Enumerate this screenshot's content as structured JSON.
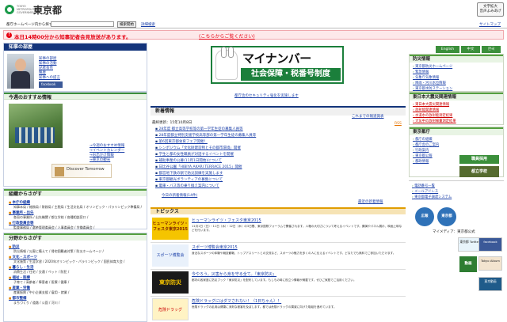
{
  "header": {
    "logo_sub": "TOKYO METROPOLITAN GOVERNMENT",
    "logo_text": "東京都",
    "text_size_button": "文字拡大\n音声よみあげ"
  },
  "search": {
    "label": "都庁ホームページ内から探す",
    "button": "検索開始",
    "detail_link": "詳細検索",
    "sitemap_link": "サイトマップ"
  },
  "alert": {
    "icon": "!",
    "text": "本日14時00分から知事記者会見放送があります。",
    "link": "(こちらからご覧ください)"
  },
  "governor": {
    "title": "知事の部屋",
    "links": [
      "知事の部屋",
      "知事の活動",
      "記者会見",
      "略歴",
      "知事への提言"
    ],
    "facebook": "facebook"
  },
  "recommend": {
    "title": "今週のおすすめ情報",
    "links": [
      "→今週のおすすめ情報",
      "→イベントカレンダー",
      "→お出かけ情報",
      "→東京の観光"
    ],
    "discover_banner": "Discover Tomorrow"
  },
  "org": {
    "title": "組織からさがす",
    "items": [
      {
        "kind": "head",
        "text": "本庁の組織"
      },
      {
        "kind": "sub",
        "text": "知事本局 / 総務局 / 財務局 / 主税局 / 生活文化局 / オリンピック・パラリンピック準備局 /"
      },
      {
        "kind": "head",
        "text": "事業所・出先"
      },
      {
        "kind": "sub",
        "text": "各局の事業所 / 出先機関 / 都立学校 / 各種相談窓口 /"
      },
      {
        "kind": "head",
        "text": "行政委員会等"
      },
      {
        "kind": "sub",
        "text": "監査事務局 / 選挙管理委員会 / 人事委員会 / 労働委員会 /"
      }
    ]
  },
  "field": {
    "title": "分野からさがす",
    "items": [
      {
        "kind": "head",
        "text": "防災"
      },
      {
        "kind": "sub",
        "text": "防災情報 / 災害に備えて / 帰宅困難者対策 / 防災ホームページ /"
      },
      {
        "kind": "head",
        "text": "文化・スポーツ"
      },
      {
        "kind": "sub",
        "text": "文化施策 / 生涯学習 / 2020年オリンピック・パラリンピック / 国民体育大会 /"
      },
      {
        "kind": "head",
        "text": "暮らし・生活"
      },
      {
        "kind": "sub",
        "text": "消費生活 / 住宅 / 交通 / ペット / 防犯 /"
      },
      {
        "kind": "head",
        "text": "福祉・医療"
      },
      {
        "kind": "sub",
        "text": "子育て / 高齢者 / 障害者 / 医療 / 健康 /"
      },
      {
        "kind": "head",
        "text": "産業・労働"
      },
      {
        "kind": "sub",
        "text": "産業振興 / 中小企業支援 / 雇用・就業 /"
      },
      {
        "kind": "head",
        "text": "都市整備"
      },
      {
        "kind": "sub",
        "text": "まちづくり / 道路 / 公園 / 河川 /"
      }
    ]
  },
  "mynumber": {
    "title": "マイナンバー",
    "subtitle": "社会保障・税番号制度",
    "caption": "都庁舎のセキュリティ強化を実施します"
  },
  "news": {
    "title": "新着情報",
    "updated": "最終更新：15年10月8日",
    "more_link": "これまでの報道発表",
    "rss": "RSS",
    "items": [
      "28年度 都立高等学校等の第一学年生徒の募集人員等",
      "28年度都立特別支援学校高等部の第一学年生徒の募集人員等",
      "第6回東京都食育フェア開催！",
      "シンポジウム「文化財建造物とその都市環境」開催",
      "学生と都の女性職員が対話するイベントを開催",
      "補助事業の公募(11月1日開始)について",
      "日比谷公園「HIBIYA AKARI TERRACE 2015」開催",
      "都営地下鉄の駅で防災訓練を実施します",
      "東京都観光ボランティアの募集について",
      "電車・バス等の乗り換え案内について"
    ],
    "list_link": "今日の新着情報(14件)",
    "latest_link": "最近の新着情報"
  },
  "topics": {
    "title": "トピックス",
    "items": [
      {
        "thumb": "ヒューマンライツ・フェスタ東京2015",
        "title": "ヒューマンライツ・フェスタ東京2015",
        "desc": "11月1日（日）・11日（水）・12日（木）の3日間、東京国際フォーラムで開催されます。人権の大切さについて考えるイベントです。講演やパネル展示、映画上映などを行います。"
      },
      {
        "thumb": "スポーツ博覧会",
        "title": "スポーツ博覧会東京2015",
        "desc": "身近なスポーツの体験や競技観戦、トップアスリートとの交流など、スポーツの魅力を多くの人に伝えるイベントです。どなたでも無料でご参加いただけます。"
      },
      {
        "thumb": "東京防災",
        "title": "今やろう。災害から身を守る全て。『東京防災』",
        "desc": "都内の各家庭に防災ブック「東京防災」を配布しています。もしもの時に役立つ情報が満載です。ぜひご家庭でご活用ください。"
      },
      {
        "thumb": "危険ドラッグ",
        "title": "危険ドラッグにはダマされない！〈1日ちゃん〉！",
        "desc": "危険ドラッグの乱用は健康に深刻な被害を及ぼします。都では危険ドラッグの撲滅に向けた取組を進めています。"
      }
    ]
  },
  "lang": {
    "buttons": [
      "English",
      "中文",
      "한국"
    ]
  },
  "disaster": {
    "title": "防災情報",
    "items": [
      "東京都防災ホームページ",
      "緊急情報",
      "気象庁気象情報",
      "降雨・河川水位情報",
      "東京都水防ステーション"
    ]
  },
  "quake": {
    "title": "東日本大震災関連情報",
    "items": [
      "東日本大震災関連情報",
      "放射能関連情報",
      "水道水の放射能測定結果",
      "大気中の放射線量測定結果"
    ]
  },
  "office": {
    "title": "東京都庁",
    "items": [
      "都庁の組織",
      "都庁舎のご案内",
      "行政案内",
      "東京都公報",
      "都政情報"
    ],
    "banner1": "職員採用",
    "banner2": "都立学校"
  },
  "elec": {
    "items": [
      "電話番号一覧",
      "メールアドレス",
      "東京都電子調達システム"
    ]
  },
  "media": {
    "title": "マイメディア：東京都公式",
    "cards": [
      "東京都 Twitter",
      "facebook",
      "Tokyo Album",
      "東京動画"
    ],
    "icons": [
      "広報",
      "東京都",
      "動画"
    ]
  },
  "colors": {
    "brand": "#13347b",
    "alert": "#e60012",
    "green": "#3b8f3b"
  }
}
